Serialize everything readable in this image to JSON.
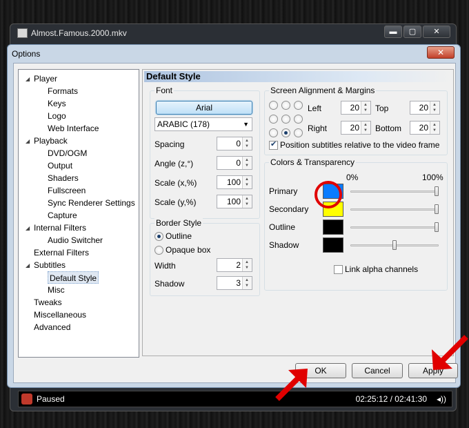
{
  "player": {
    "title": "Almost.Famous.2000.mkv",
    "status": "Paused",
    "time": "02:25:12 / 02:41:30",
    "window_buttons": [
      "▬",
      "▢",
      "✕"
    ],
    "volume_icon": "speaker-icon"
  },
  "dialog": {
    "title": "Options",
    "close_label": "✕",
    "tree": [
      {
        "label": "Player",
        "level": 0,
        "expanded": true
      },
      {
        "label": "Formats",
        "level": 1
      },
      {
        "label": "Keys",
        "level": 1
      },
      {
        "label": "Logo",
        "level": 1
      },
      {
        "label": "Web Interface",
        "level": 1
      },
      {
        "label": "Playback",
        "level": 0,
        "expanded": true
      },
      {
        "label": "DVD/OGM",
        "level": 1
      },
      {
        "label": "Output",
        "level": 1
      },
      {
        "label": "Shaders",
        "level": 1
      },
      {
        "label": "Fullscreen",
        "level": 1
      },
      {
        "label": "Sync Renderer Settings",
        "level": 1
      },
      {
        "label": "Capture",
        "level": 1
      },
      {
        "label": "Internal Filters",
        "level": 0,
        "expanded": true
      },
      {
        "label": "Audio Switcher",
        "level": 1
      },
      {
        "label": "External Filters",
        "level": 0
      },
      {
        "label": "Subtitles",
        "level": 0,
        "expanded": true
      },
      {
        "label": "Default Style",
        "level": 1,
        "selected": true
      },
      {
        "label": "Misc",
        "level": 1
      },
      {
        "label": "Tweaks",
        "level": 0
      },
      {
        "label": "Miscellaneous",
        "level": 0
      },
      {
        "label": "Advanced",
        "level": 0
      }
    ],
    "panel_title": "Default Style",
    "font": {
      "group_label": "Font",
      "font_button": "Arial",
      "charset": "ARABIC (178)",
      "spacing_label": "Spacing",
      "spacing": "0",
      "angle_label": "Angle (z,°)",
      "angle": "0",
      "scalex_label": "Scale (x,%)",
      "scalex": "100",
      "scaley_label": "Scale (y,%)",
      "scaley": "100"
    },
    "border": {
      "group_label": "Border Style",
      "outline_label": "Outline",
      "opaque_label": "Opaque box",
      "width_label": "Width",
      "width": "2",
      "shadow_label": "Shadow",
      "shadow": "3"
    },
    "alignment": {
      "group_label": "Screen Alignment & Margins",
      "left_label": "Left",
      "left": "20",
      "top_label": "Top",
      "top": "20",
      "right_label": "Right",
      "right": "20",
      "bottom_label": "Bottom",
      "bottom": "20",
      "position_check": "Position subtitles relative to the video frame"
    },
    "colors": {
      "group_label": "Colors & Transparency",
      "pct_min": "0%",
      "pct_max": "100%",
      "rows": [
        {
          "label": "Primary",
          "color": "#0a7cff",
          "alpha": 1.0
        },
        {
          "label": "Secondary",
          "color": "#ffff00",
          "alpha": 1.0
        },
        {
          "label": "Outline",
          "color": "#000000",
          "alpha": 1.0
        },
        {
          "label": "Shadow",
          "color": "#000000",
          "alpha": 0.5
        }
      ],
      "link_alpha": "Link alpha channels"
    },
    "buttons": {
      "ok": "OK",
      "cancel": "Cancel",
      "apply": "Apply"
    }
  },
  "annotation_color": "#e00000"
}
